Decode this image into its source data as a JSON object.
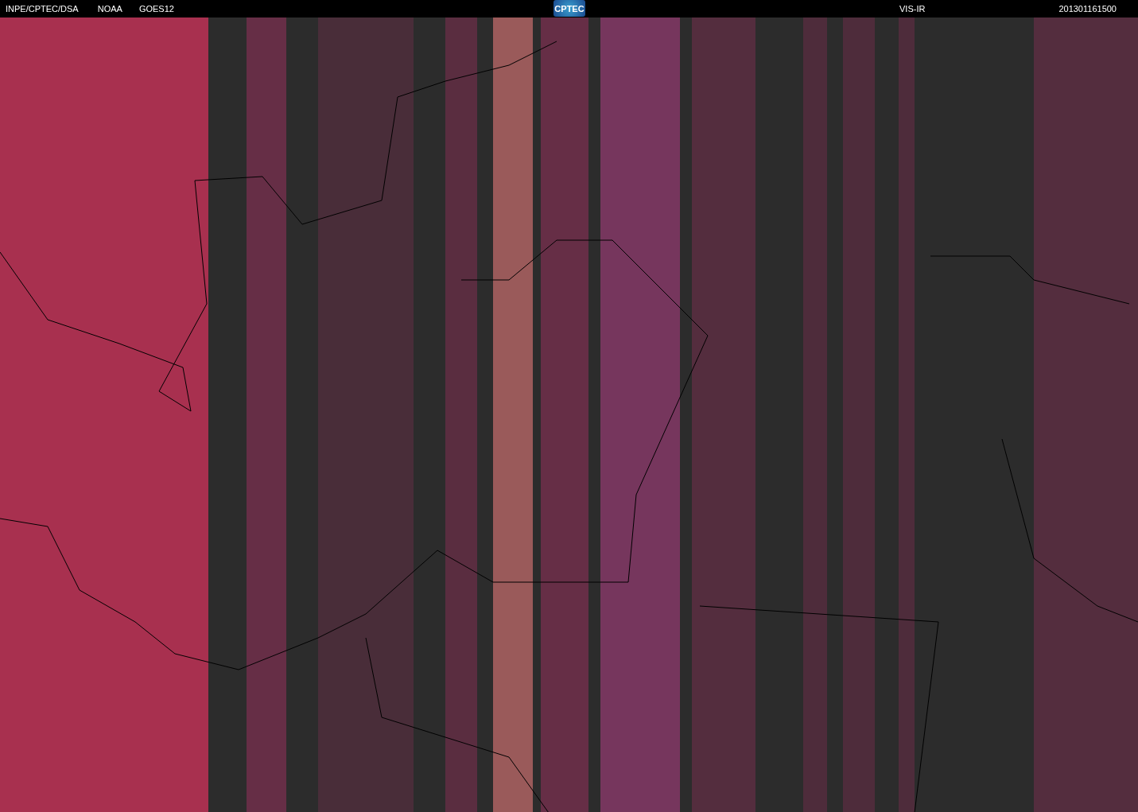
{
  "header": {
    "source": "INPE/CPTEC/DSA",
    "agency": "NOAA",
    "satellite": "GOES12",
    "logo": "CPTEC",
    "channel": "VIS-IR",
    "timestamp": "201301161500"
  }
}
